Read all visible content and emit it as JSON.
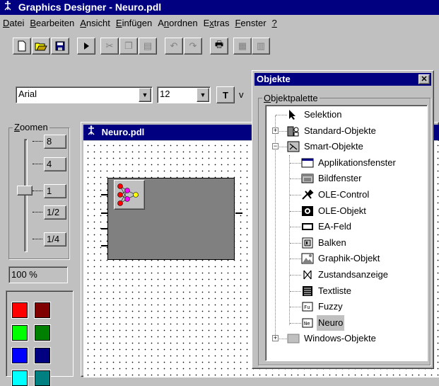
{
  "app": {
    "title": "Graphics Designer - Neuro.pdl",
    "icon": "stickfigure-app-icon"
  },
  "menu": [
    "Datei",
    "Bearbeiten",
    "Ansicht",
    "Einfügen",
    "Anordnen",
    "Extras",
    "Fenster",
    "?"
  ],
  "toolbar": {
    "buttons": [
      "new-icon",
      "open-icon",
      "save-icon",
      "run-icon",
      "cut-icon",
      "copy-icon",
      "paste-icon",
      "undo-icon",
      "redo-icon",
      "print-icon",
      "layers-icon",
      "properties-icon",
      "grid-icon",
      "snap-icon",
      "zoom-icon"
    ]
  },
  "fontbar": {
    "font_name": "Arial",
    "font_size": "12",
    "truncated_label": "v"
  },
  "zoom": {
    "label": "Zoomen",
    "levels": [
      "8",
      "4",
      "1",
      "1/2",
      "1/4"
    ],
    "current_level": "1",
    "value": "100 %"
  },
  "palette": {
    "colors": [
      "#ff0000",
      "#800000",
      "#00ff00",
      "#008000",
      "#0000ff",
      "#000080",
      "#00ffff",
      "#008080"
    ]
  },
  "document": {
    "title": "Neuro.pdl",
    "icon": "stickfigure-doc-icon",
    "object_icon": "neural-network-icon"
  },
  "objekte": {
    "title": "Objekte",
    "group_label": "Objektpalette",
    "tree": [
      {
        "label": "Selektion",
        "icon": "arrow-cursor-icon",
        "level": 0
      },
      {
        "label": "Standard-Objekte",
        "icon": "shapes-icon",
        "level": 0,
        "expander": "+"
      },
      {
        "label": "Smart-Objekte",
        "icon": "smart-icon",
        "level": 0,
        "expander": "−"
      },
      {
        "label": "Applikationsfenster",
        "icon": "app-window-icon",
        "level": 1
      },
      {
        "label": "Bildfenster",
        "icon": "picture-window-icon",
        "level": 1
      },
      {
        "label": "OLE-Control",
        "icon": "tools-icon",
        "level": 1
      },
      {
        "label": "OLE-Objekt",
        "icon": "ole-object-icon",
        "level": 1
      },
      {
        "label": "EA-Feld",
        "icon": "io-field-icon",
        "level": 1
      },
      {
        "label": "Balken",
        "icon": "bar-icon",
        "level": 1
      },
      {
        "label": "Graphik-Objekt",
        "icon": "graphic-object-icon",
        "level": 1
      },
      {
        "label": "Zustandsanzeige",
        "icon": "status-display-icon",
        "level": 1
      },
      {
        "label": "Textliste",
        "icon": "text-list-icon",
        "level": 1
      },
      {
        "label": "Fuzzy",
        "icon": "fuzzy-icon",
        "level": 1
      },
      {
        "label": "Neuro",
        "icon": "neuro-icon",
        "level": 1,
        "selected": true
      },
      {
        "label": "Windows-Objekte",
        "icon": "windows-objects-icon",
        "level": 0,
        "expander": "+"
      }
    ]
  }
}
